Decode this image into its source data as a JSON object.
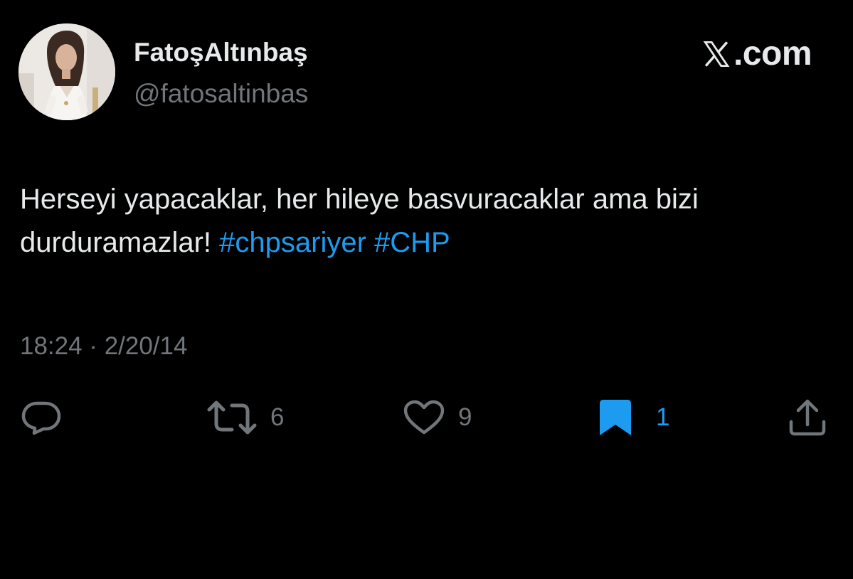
{
  "author": {
    "display_name": "FatoşAltınbaş",
    "handle": "@fatosaltinbas",
    "avatar_icon": "profile-photo"
  },
  "brand": {
    "icon": "x-logo-icon",
    "text": ".com"
  },
  "tweet": {
    "text_plain": "Herseyi yapacaklar, her hileye basvuracaklar ama bizi durduramazlar!",
    "hashtags": [
      "#chpsariyer",
      "#CHP"
    ],
    "timestamp": "18:24 · 2/20/14"
  },
  "actions": {
    "reply": {
      "icon": "reply-icon"
    },
    "retweet": {
      "icon": "retweet-icon",
      "count": "6"
    },
    "like": {
      "icon": "heart-icon",
      "count": "9"
    },
    "bookmark": {
      "icon": "bookmark-filled-icon",
      "count": "1",
      "active": true
    },
    "share": {
      "icon": "share-icon"
    }
  },
  "colors": {
    "background": "#000000",
    "primary_text": "#e7e9ea",
    "secondary_text": "#71767b",
    "accent": "#1d9bf0"
  }
}
